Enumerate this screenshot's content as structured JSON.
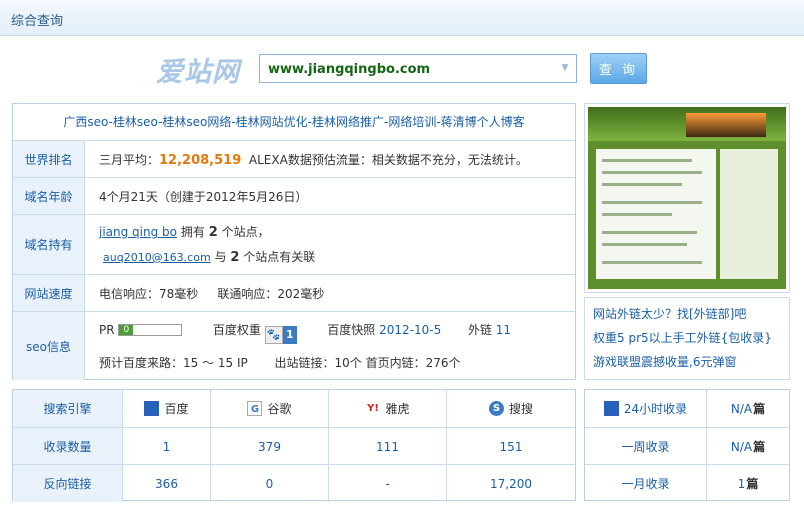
{
  "header": {
    "title": "综合查询"
  },
  "search": {
    "logo": "爱站网",
    "value": "www.jiangqingbo.com",
    "button": "查 询"
  },
  "site_title": "广西seo-桂林seo-桂林seo网络-桂林网站优化-桂林网络推广-网络培训-蒋清博个人博客",
  "world_rank": {
    "label": "世界排名",
    "prefix": "三月平均：",
    "value": "12,208,519",
    "note": "ALEXA数据预估流量：相关数据不充分，无法统计。"
  },
  "domain_age": {
    "label": "域名年龄",
    "value": "4个月21天（创建于2012年5月26日）"
  },
  "domain_owner": {
    "label": "域名持有",
    "name": "jiang qing bo",
    "owns_prefix": "拥有",
    "owns_count": "2",
    "owns_suffix": "个站点，",
    "email": "auq2010@163.com",
    "rel_prefix": "与",
    "rel_count": "2",
    "rel_suffix": "个站点有关联"
  },
  "speed": {
    "label": "网站速度",
    "telecom": "电信响应：78毫秒",
    "unicom": "联通响应：202毫秒"
  },
  "seo": {
    "label": "seo信息",
    "pr_label": "PR",
    "pr_value": "0",
    "baidu_weight_label": "百度权重",
    "baidu_weight_value": "1",
    "snapshot_label": "百度快照",
    "snapshot_value": "2012-10-5",
    "outlinks_label": "外链",
    "outlinks_value": "11",
    "estimate": "预计百度来路：15 ～ 15 IP",
    "out_links": "出站链接：10个",
    "home_links": "首页内链：276个"
  },
  "ads": [
    "网站外链太少？找[外链部]吧",
    "权重5 pr5以上手工外链{包收录}",
    "游戏联盟震撼收量,6元弹窗"
  ],
  "engines": {
    "header_label": "搜索引擎",
    "names": [
      "百度",
      "谷歌",
      "雅虎",
      "搜搜"
    ],
    "icons": [
      "baidu-paw-icon",
      "google-g-icon",
      "yahoo-y-icon",
      "soso-s-icon"
    ],
    "index_label": "收录数量",
    "index": [
      "1",
      "379",
      "111",
      "151"
    ],
    "backlink_label": "反向链接",
    "backlinks": [
      "366",
      "0",
      "-",
      "17,200"
    ]
  },
  "stats": {
    "rows": [
      {
        "label": "24小时收录",
        "value": "N/A",
        "unit": "篇"
      },
      {
        "label": "一周收录",
        "value": "N/A",
        "unit": "篇"
      },
      {
        "label": "一月收录",
        "value": "1",
        "unit": "篇"
      }
    ]
  },
  "colors": {
    "accent": "#1a5fa6",
    "rank": "#e6790c",
    "domain_text": "#136613"
  }
}
